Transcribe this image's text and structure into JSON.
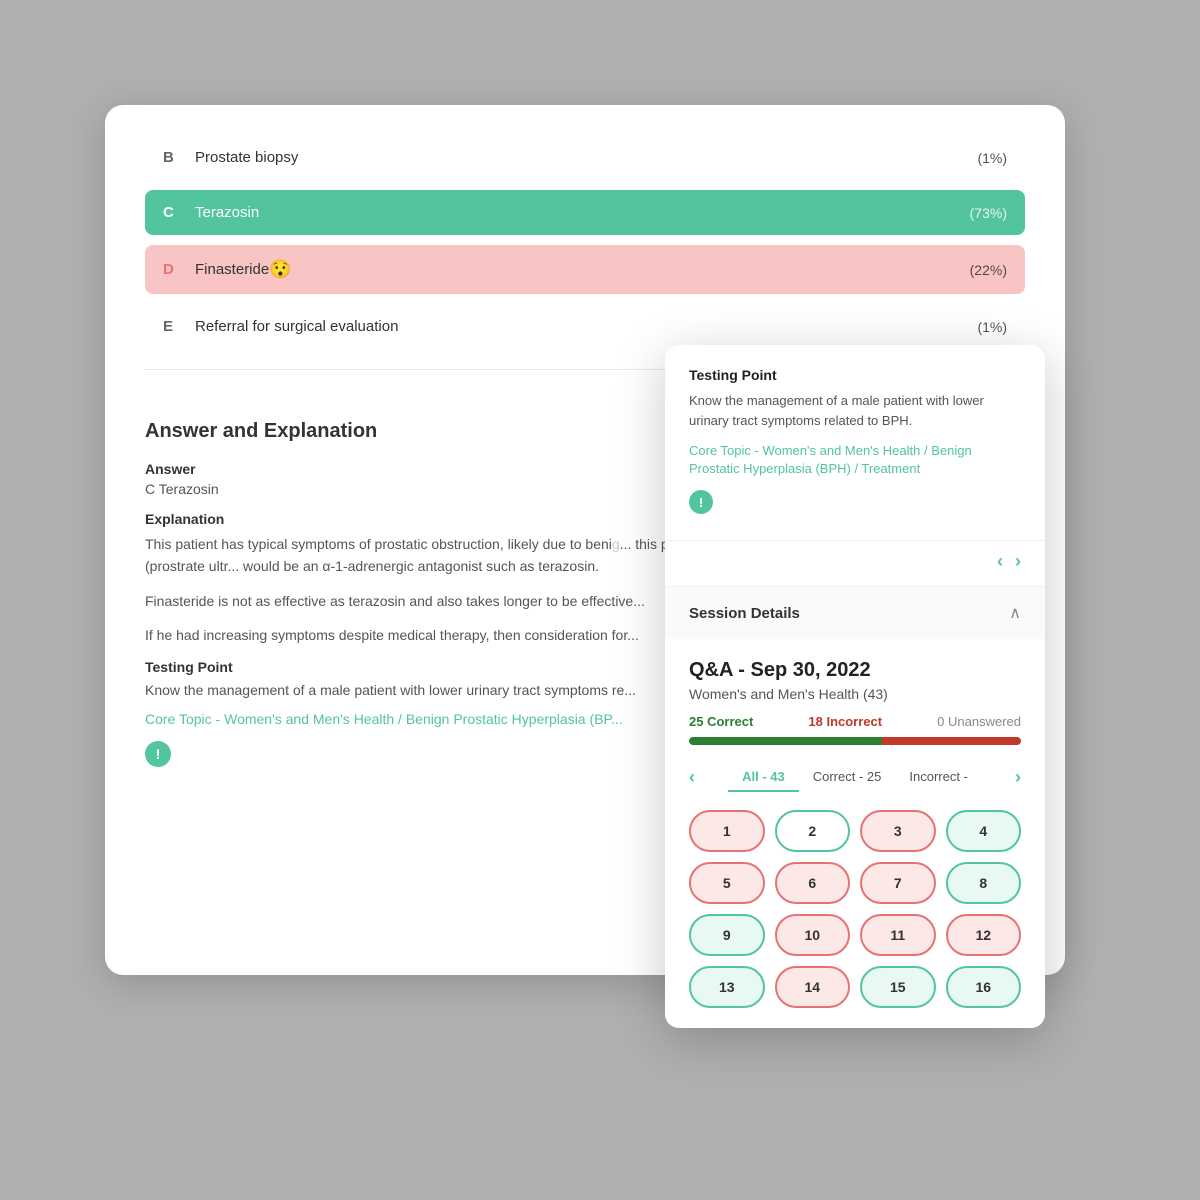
{
  "background": "#b0b0b0",
  "main_card": {
    "answer_options": [
      {
        "letter": "B",
        "text": "Prostate biopsy",
        "type": "neutral",
        "percent": "(1%)"
      },
      {
        "letter": "C",
        "text": "Terazosin",
        "type": "correct",
        "percent": "(73%)"
      },
      {
        "letter": "D",
        "text": "Finasteride",
        "type": "incorrect",
        "percent": "(22%)",
        "emoji": "😯"
      },
      {
        "letter": "E",
        "text": "Referral for surgical evaluation",
        "type": "neutral",
        "percent": "(1%)"
      }
    ],
    "section_title": "Answer and Explanation",
    "answer_label": "Answer",
    "answer_value": "C   Terazosin",
    "explanation_label": "Explanation",
    "explanation_paragraphs": [
      "This patient has typical symptoms of prostatic obstruction, likely due to benig... this point, he does not need further workup for prostate cancer (prostrate ultr... would be an α-1-adrenergic antagonist such as terazosin.",
      "Finasteride is not as effective as terazosin and also takes longer to be effective...",
      "If he had increasing symptoms despite medical therapy, then consideration for..."
    ],
    "testing_point_label": "Testing Point",
    "testing_point_text": "Know the management of a male patient with lower urinary tract symptoms re...",
    "core_topic_link": "Core Topic - Women's and Men's Health / Benign Prostatic Hyperplasia (BP...",
    "alert_icon": "!"
  },
  "popup": {
    "testing_point_title": "Testing Point",
    "testing_point_text": "Know the management of a male patient with lower urinary tract symptoms related to BPH.",
    "core_topic_link": "Core Topic - Women's and Men's Health / Benign Prostatic Hyperplasia (BPH) / Treatment",
    "alert_icon": "!",
    "nav_prev": "‹",
    "nav_next": "›",
    "session_details_label": "Session Details",
    "collapse_icon": "∧",
    "qa_title": "Q&A - Sep 30, 2022",
    "subject": "Women's and Men's Health (43)",
    "stat_correct": "25 Correct",
    "stat_incorrect": "18 Incorrect",
    "stat_unanswered": "0 Unanswered",
    "progress_correct_pct": 58,
    "progress_incorrect_pct": 42,
    "filter_tabs": [
      {
        "label": "All - 43",
        "active": true
      },
      {
        "label": "Correct - 25",
        "active": false
      },
      {
        "label": "Incorrect -",
        "active": false
      }
    ],
    "questions": [
      {
        "num": 1,
        "type": "incorrect"
      },
      {
        "num": 2,
        "type": "incorrect",
        "active": true
      },
      {
        "num": 3,
        "type": "incorrect"
      },
      {
        "num": 4,
        "type": "correct"
      },
      {
        "num": 5,
        "type": "incorrect"
      },
      {
        "num": 6,
        "type": "incorrect"
      },
      {
        "num": 7,
        "type": "incorrect"
      },
      {
        "num": 8,
        "type": "correct"
      },
      {
        "num": 9,
        "type": "correct"
      },
      {
        "num": 10,
        "type": "incorrect"
      },
      {
        "num": 11,
        "type": "incorrect"
      },
      {
        "num": 12,
        "type": "incorrect"
      },
      {
        "num": 13,
        "type": "correct"
      },
      {
        "num": 14,
        "type": "incorrect"
      },
      {
        "num": 15,
        "type": "correct"
      },
      {
        "num": 16,
        "type": "correct"
      }
    ]
  }
}
